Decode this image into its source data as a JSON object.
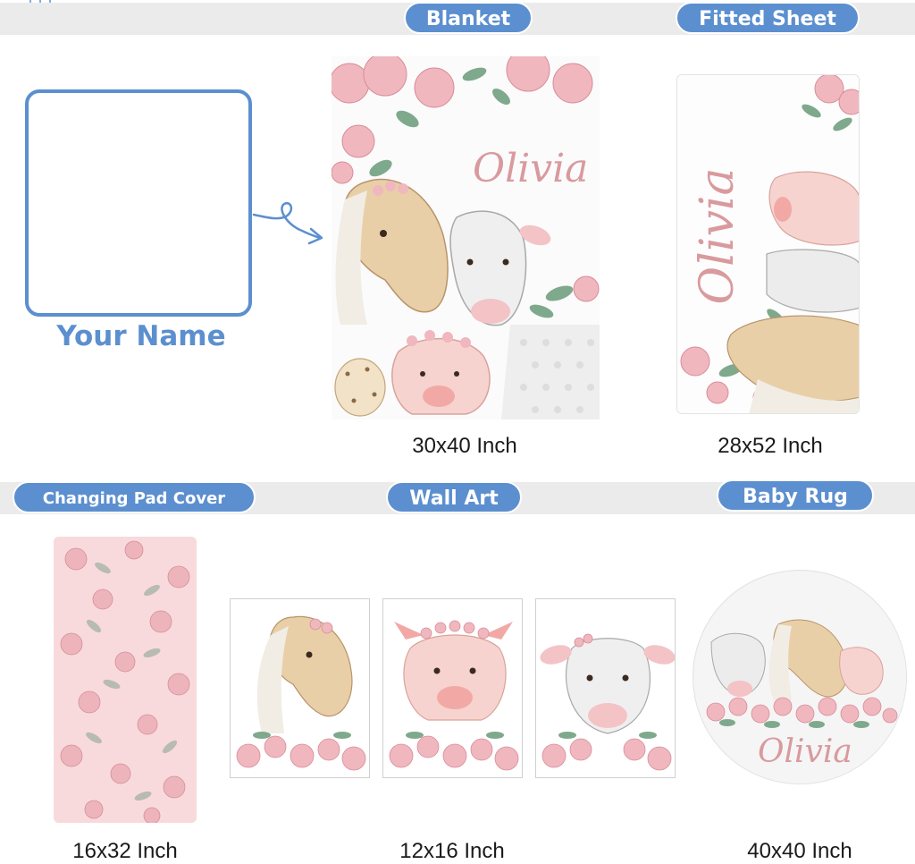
{
  "colors": {
    "accent": "#5c8fcf",
    "band": "#ebebeb",
    "script_pink": "#d99a9e",
    "rose": "#f0b7bf",
    "leaf": "#7fa98c"
  },
  "placeholder": {
    "caption": "Your Name"
  },
  "products": {
    "blanket": {
      "label": "Blanket",
      "size": "30x40 Inch",
      "name": "Olivia"
    },
    "fitted_sheet": {
      "label": "Fitted Sheet",
      "size": "28x52 Inch",
      "name": "Olivia"
    },
    "changing_pad": {
      "label": "Changing Pad Cover",
      "size": "16x32 Inch"
    },
    "wall_art": {
      "label": "Wall Art",
      "size": "12x16 Inch"
    },
    "baby_rug": {
      "label": "Baby Rug",
      "size": "40x40 Inch",
      "name": "Olivia"
    }
  },
  "icons": [
    "hanging-stars-icon",
    "curly-arrow-icon"
  ]
}
